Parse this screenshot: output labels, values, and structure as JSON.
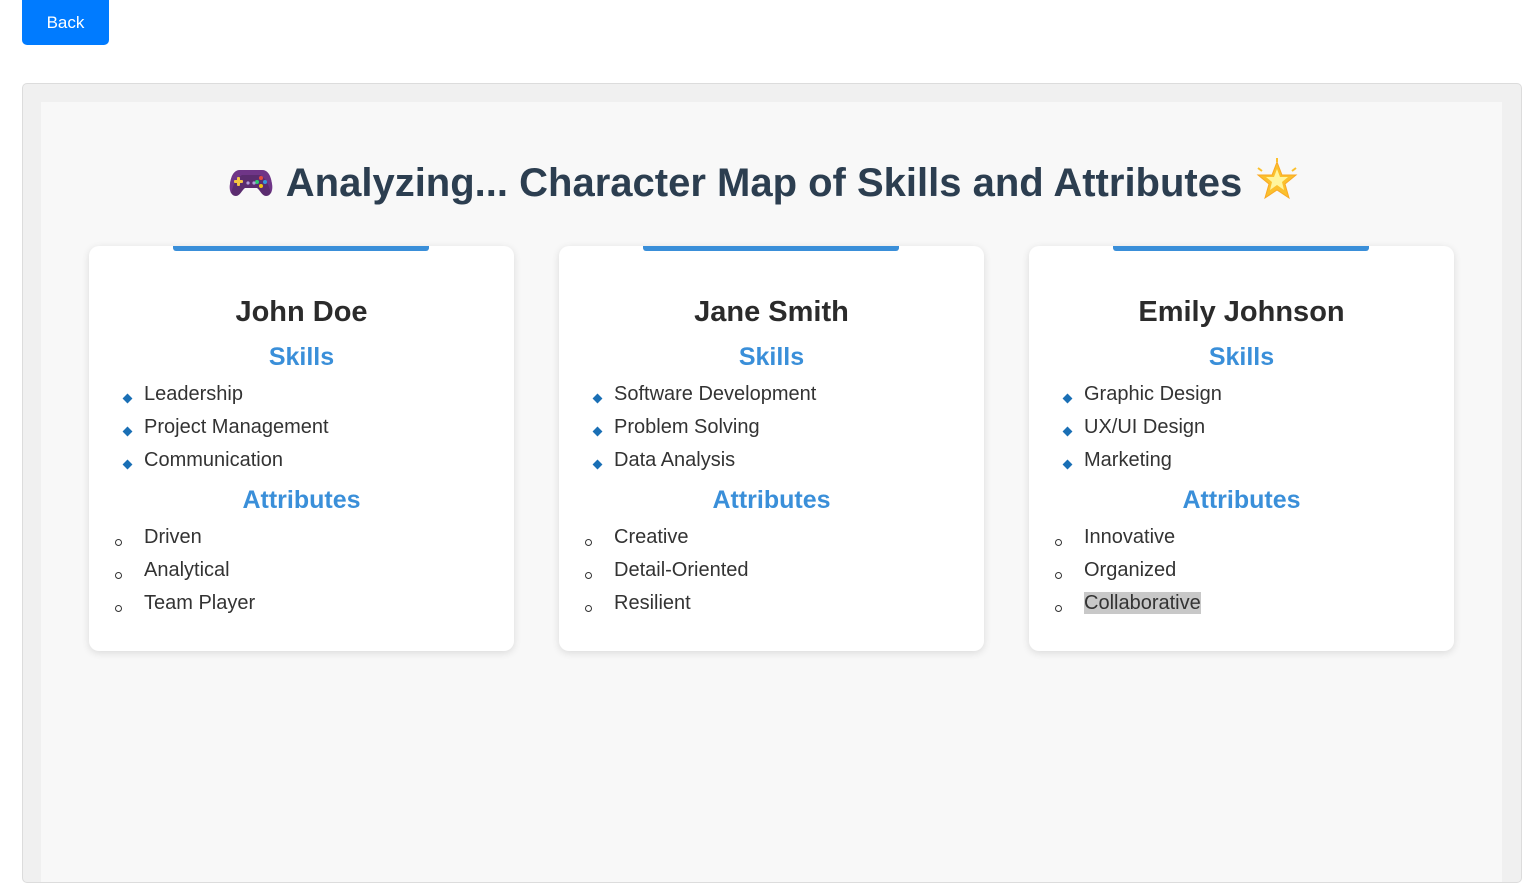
{
  "toolbar": {
    "back_label": "Back"
  },
  "header": {
    "title": "Analyzing... Character Map of Skills and Attributes",
    "leading_icon": "game-controller-icon",
    "trailing_icon": "glowing-star-icon"
  },
  "colors": {
    "accent": "#3a8fd9",
    "button": "#007bff",
    "title": "#2c3e50",
    "diamond_bullet": "#1a6fb5"
  },
  "cards": [
    {
      "name": "John Doe",
      "skills_heading": "Skills",
      "skills": [
        "Leadership",
        "Project Management",
        "Communication"
      ],
      "attributes_heading": "Attributes",
      "attributes": [
        "Driven",
        "Analytical",
        "Team Player"
      ]
    },
    {
      "name": "Jane Smith",
      "skills_heading": "Skills",
      "skills": [
        "Software Development",
        "Problem Solving",
        "Data Analysis"
      ],
      "attributes_heading": "Attributes",
      "attributes": [
        "Creative",
        "Detail-Oriented",
        "Resilient"
      ]
    },
    {
      "name": "Emily Johnson",
      "skills_heading": "Skills",
      "skills": [
        "Graphic Design",
        "UX/UI Design",
        "Marketing"
      ],
      "attributes_heading": "Attributes",
      "attributes": [
        "Innovative",
        "Organized",
        "Collaborative"
      ]
    }
  ]
}
